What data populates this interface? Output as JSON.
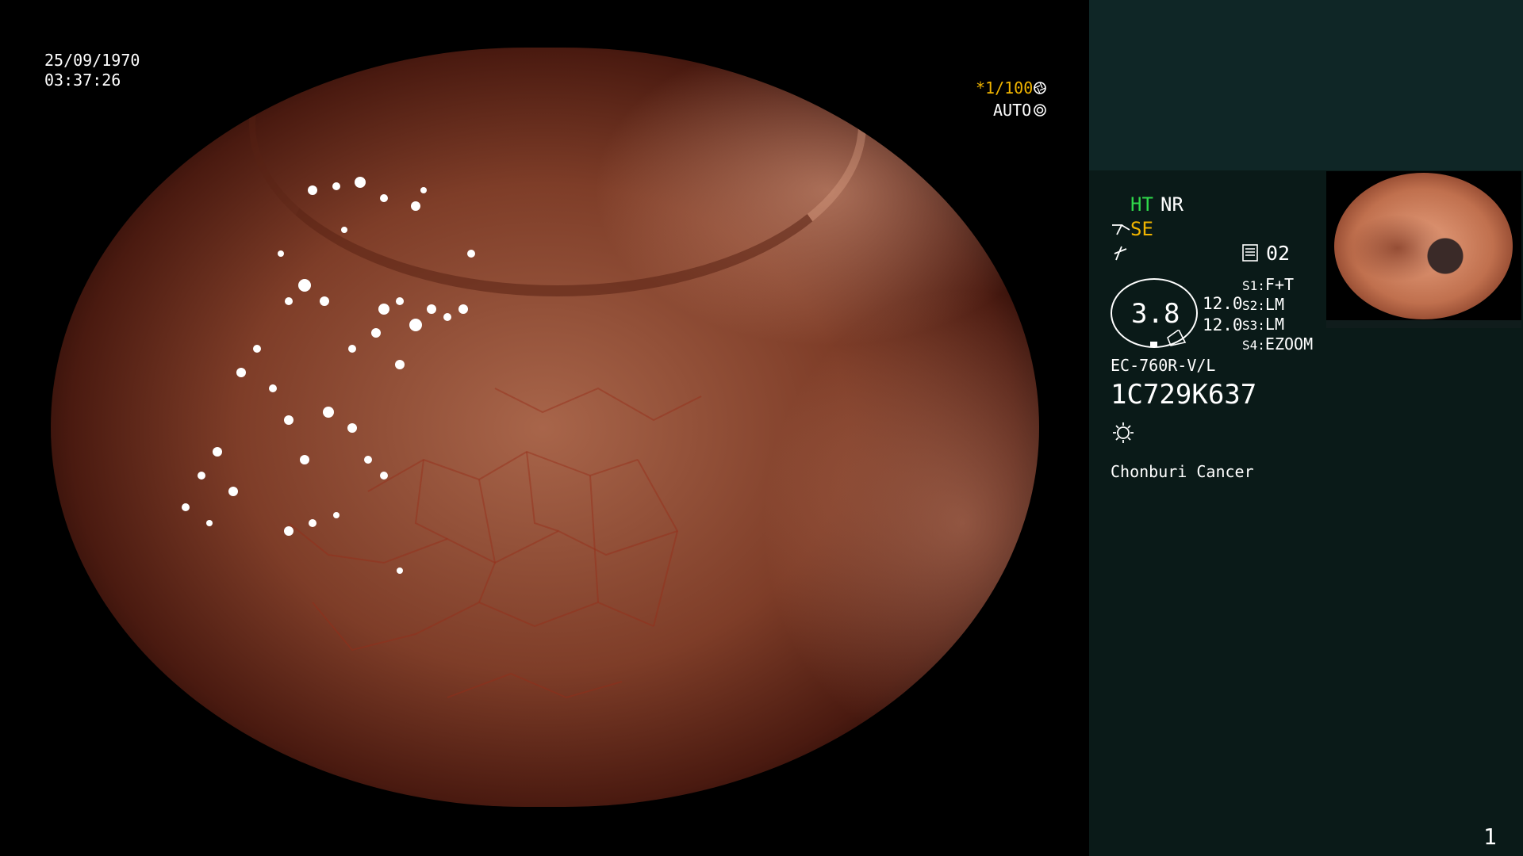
{
  "scope": {
    "date": "25/09/1970",
    "time": "03:37:26",
    "shutter": "*1/100",
    "iris": "AUTO"
  },
  "panel": {
    "ht": "HT",
    "nr": "NR",
    "se": "SE",
    "memory_label": "02",
    "zoom_value": "3.8",
    "zoom_a": "12.0",
    "zoom_b": "12.0",
    "switches": [
      {
        "key": "S1:",
        "value": "F+T"
      },
      {
        "key": "S2:",
        "value": "LM"
      },
      {
        "key": "S3:",
        "value": "LM"
      },
      {
        "key": "S4:",
        "value": "EZOOM"
      }
    ],
    "scope_model": "EC-760R-V/L",
    "scope_serial": "1C729K637",
    "hospital": "Chonburi Cancer",
    "page_number": "1"
  },
  "colors": {
    "mode_green": "#2fd84a",
    "mode_yellow": "#f0b400",
    "panel_bg": "#0a1a18"
  },
  "icons": {
    "shutter": "aperture-icon",
    "iris": "iris-icon",
    "enhance": "structure-enhance-icon",
    "color": "color-tone-icon",
    "memory": "memory-card-icon",
    "light": "light-source-icon"
  }
}
